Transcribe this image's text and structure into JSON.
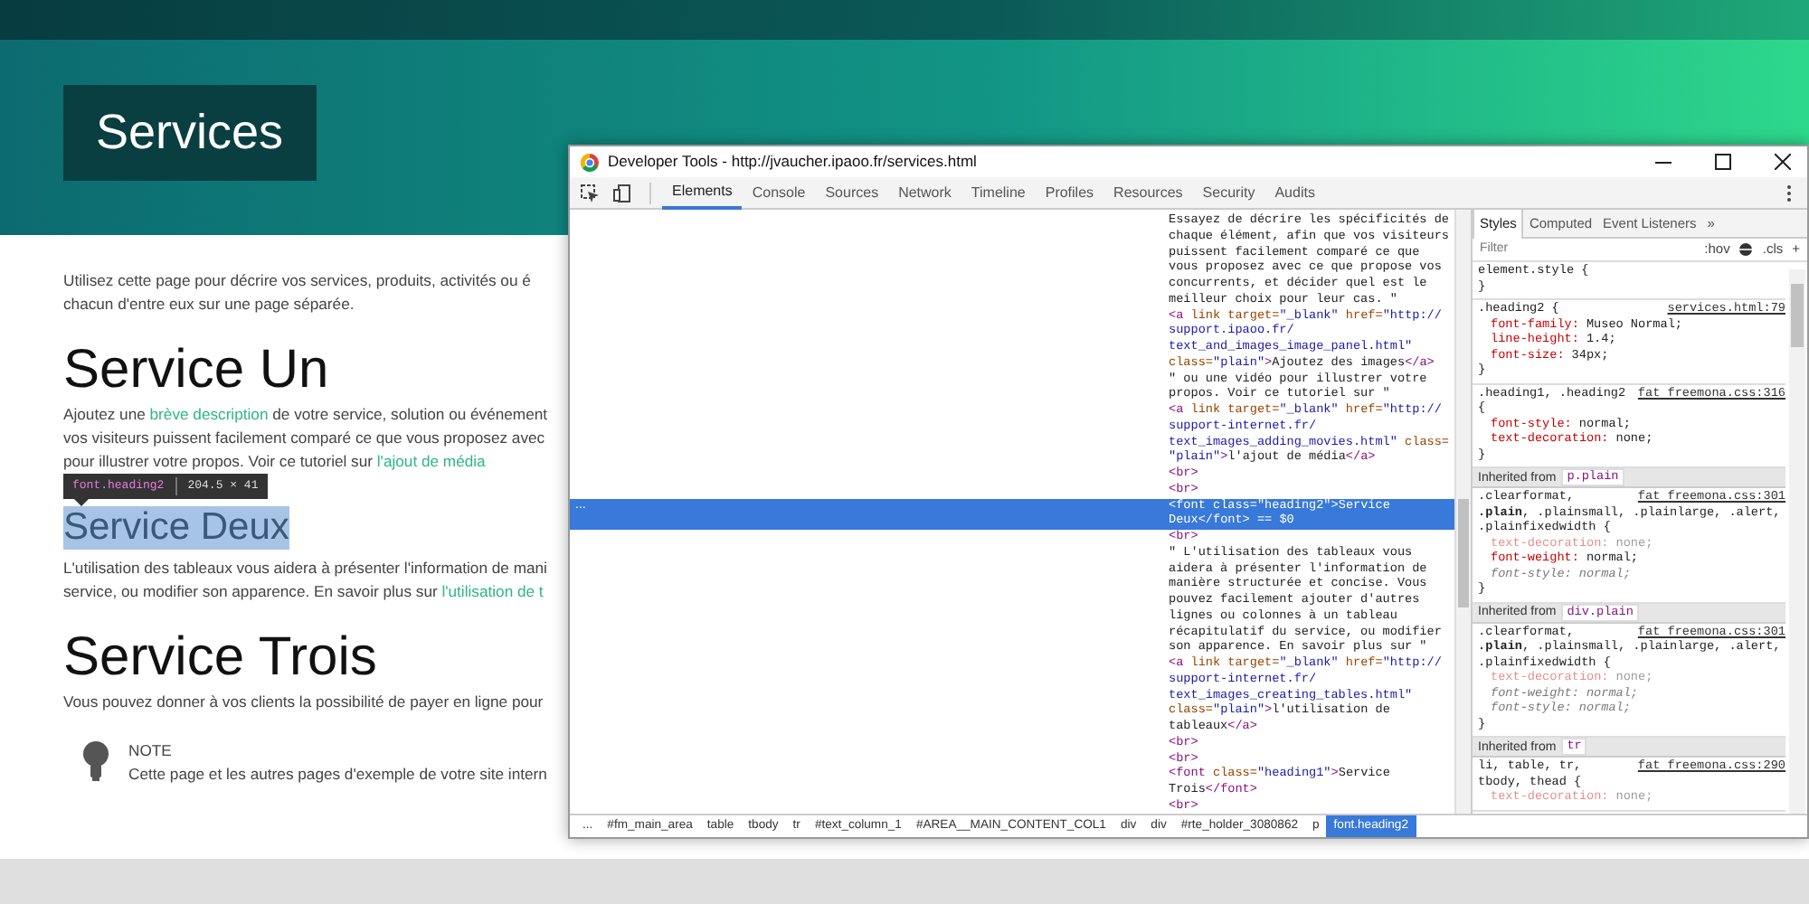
{
  "page": {
    "title": "Services",
    "blocks": [
      {
        "kind": "para",
        "lines": [
          {
            "parts": [
              {
                "kind": "text",
                "text": "Utilisez cette page pour décrire vos services, produits, activités ou é"
              }
            ]
          },
          {
            "parts": [
              {
                "kind": "text",
                "text": "chacun d'entre eux sur une page séparée."
              }
            ]
          }
        ]
      },
      {
        "kind": "heading",
        "text": "Service Un",
        "selected": false
      },
      {
        "kind": "para",
        "lines": [
          {
            "parts": [
              {
                "kind": "text",
                "text": "Ajoutez une "
              },
              {
                "kind": "link",
                "text": "brève description"
              },
              {
                "kind": "text",
                "text": " de votre service, solution ou événement"
              }
            ]
          },
          {
            "parts": [
              {
                "kind": "text",
                "text": "vos visiteurs puissent facilement comparé ce que vous proposez avec"
              }
            ]
          },
          {
            "parts": [
              {
                "kind": "text",
                "text": "pour illustrer votre propos. Voir ce tutoriel sur "
              },
              {
                "kind": "link",
                "text": "l'ajout de média"
              }
            ]
          }
        ]
      },
      {
        "kind": "subheading",
        "text": "Service Deux",
        "selected": true,
        "tooltip": {
          "selector": "font.heading2",
          "size": "204.5 × 41"
        }
      },
      {
        "kind": "para",
        "lines": [
          {
            "parts": [
              {
                "kind": "text",
                "text": "L'utilisation des tableaux vous aidera à présenter l'information de mani"
              }
            ]
          },
          {
            "parts": [
              {
                "kind": "text",
                "text": "service, ou modifier son apparence. En savoir plus sur "
              },
              {
                "kind": "link",
                "text": "l'utilisation de t"
              }
            ]
          }
        ]
      },
      {
        "kind": "heading",
        "text": "Service Trois",
        "selected": false
      },
      {
        "kind": "para",
        "lines": [
          {
            "parts": [
              {
                "kind": "text",
                "text": "Vous pouvez donner à vos clients la possibilité de payer en ligne pour"
              }
            ]
          }
        ]
      },
      {
        "kind": "note",
        "title": "NOTE",
        "text": "Cette page et les autres pages d'exemple de votre site intern"
      }
    ]
  },
  "devtools": {
    "title": "Developer Tools - http://jvaucher.ipaoo.fr/services.html",
    "tabs": [
      {
        "label": "Elements",
        "selected": true
      },
      {
        "label": "Console",
        "selected": false
      },
      {
        "label": "Sources",
        "selected": false
      },
      {
        "label": "Network",
        "selected": false
      },
      {
        "label": "Timeline",
        "selected": false
      },
      {
        "label": "Profiles",
        "selected": false
      },
      {
        "label": "Resources",
        "selected": false
      },
      {
        "label": "Security",
        "selected": false
      },
      {
        "label": "Audits",
        "selected": false
      }
    ],
    "elements": {
      "gutter": "...",
      "lines": [
        {
          "selected": false,
          "parts": [
            {
              "kind": "text",
              "text": "Essayez de décrire les spécificités de"
            }
          ]
        },
        {
          "selected": false,
          "parts": [
            {
              "kind": "text",
              "text": "chaque élément, afin que vos visiteurs"
            }
          ]
        },
        {
          "selected": false,
          "parts": [
            {
              "kind": "text",
              "text": "puissent facilement comparé ce que"
            }
          ]
        },
        {
          "selected": false,
          "parts": [
            {
              "kind": "text",
              "text": "vous proposez avec ce que propose vos"
            }
          ]
        },
        {
          "selected": false,
          "parts": [
            {
              "kind": "text",
              "text": "concurrents, et décider quel est le"
            }
          ]
        },
        {
          "selected": false,
          "parts": [
            {
              "kind": "text",
              "text": "meilleur choix pour leur cas. \""
            }
          ]
        },
        {
          "selected": false,
          "parts": [
            {
              "kind": "tag",
              "text": "<a"
            },
            {
              "kind": "attr",
              "text": " link target="
            },
            {
              "kind": "value",
              "text": "\"_blank\""
            },
            {
              "kind": "attr",
              "text": " href="
            },
            {
              "kind": "value",
              "text": "\"http://"
            }
          ]
        },
        {
          "selected": false,
          "parts": [
            {
              "kind": "value",
              "text": "support.ipaoo.fr/"
            }
          ]
        },
        {
          "selected": false,
          "parts": [
            {
              "kind": "value",
              "text": "text_and_images_image_panel.html\""
            }
          ]
        },
        {
          "selected": false,
          "parts": [
            {
              "kind": "attr",
              "text": "class="
            },
            {
              "kind": "value",
              "text": "\"plain\""
            },
            {
              "kind": "tag",
              "text": ">"
            },
            {
              "kind": "text",
              "text": "Ajoutez des images"
            },
            {
              "kind": "tag",
              "text": "</a>"
            }
          ]
        },
        {
          "selected": false,
          "parts": [
            {
              "kind": "text",
              "text": "\" ou une vidéo pour illustrer votre"
            }
          ]
        },
        {
          "selected": false,
          "parts": [
            {
              "kind": "text",
              "text": "propos. Voir ce tutoriel sur \""
            }
          ]
        },
        {
          "selected": false,
          "parts": [
            {
              "kind": "tag",
              "text": "<a"
            },
            {
              "kind": "attr",
              "text": " link target="
            },
            {
              "kind": "value",
              "text": "\"_blank\""
            },
            {
              "kind": "attr",
              "text": " href="
            },
            {
              "kind": "value",
              "text": "\"http://"
            }
          ]
        },
        {
          "selected": false,
          "parts": [
            {
              "kind": "value",
              "text": "support-internet.fr/"
            }
          ]
        },
        {
          "selected": false,
          "parts": [
            {
              "kind": "value",
              "text": "text_images_adding_movies.html\""
            },
            {
              "kind": "attr",
              "text": " class="
            }
          ]
        },
        {
          "selected": false,
          "parts": [
            {
              "kind": "value",
              "text": "\"plain\""
            },
            {
              "kind": "tag",
              "text": ">"
            },
            {
              "kind": "text",
              "text": "l'ajout de média"
            },
            {
              "kind": "tag",
              "text": "</a>"
            }
          ]
        },
        {
          "selected": false,
          "parts": [
            {
              "kind": "tag",
              "text": "<br>"
            }
          ]
        },
        {
          "selected": false,
          "parts": [
            {
              "kind": "tag",
              "text": "<br>"
            }
          ]
        },
        {
          "selected": true,
          "parts": [
            {
              "kind": "tag",
              "text": "<font"
            },
            {
              "kind": "attr",
              "text": " class="
            },
            {
              "kind": "value",
              "text": "\"heading2\""
            },
            {
              "kind": "tag",
              "text": ">"
            },
            {
              "kind": "text",
              "text": "Service"
            }
          ]
        },
        {
          "selected": true,
          "parts": [
            {
              "kind": "text",
              "text": "Deux"
            },
            {
              "kind": "tag",
              "text": "</font>"
            },
            {
              "kind": "dim",
              "text": " == $0"
            }
          ]
        },
        {
          "selected": false,
          "parts": [
            {
              "kind": "tag",
              "text": "<br>"
            }
          ]
        },
        {
          "selected": false,
          "parts": [
            {
              "kind": "text",
              "text": "\" L'utilisation des tableaux vous"
            }
          ]
        },
        {
          "selected": false,
          "parts": [
            {
              "kind": "text",
              "text": "aidera à présenter l'information de"
            }
          ]
        },
        {
          "selected": false,
          "parts": [
            {
              "kind": "text",
              "text": "manière structurée et concise. Vous"
            }
          ]
        },
        {
          "selected": false,
          "parts": [
            {
              "kind": "text",
              "text": "pouvez facilement ajouter d'autres"
            }
          ]
        },
        {
          "selected": false,
          "parts": [
            {
              "kind": "text",
              "text": "lignes ou colonnes à un tableau"
            }
          ]
        },
        {
          "selected": false,
          "parts": [
            {
              "kind": "text",
              "text": "récapitulatif du service, ou modifier"
            }
          ]
        },
        {
          "selected": false,
          "parts": [
            {
              "kind": "text",
              "text": "son apparence. En savoir plus sur \""
            }
          ]
        },
        {
          "selected": false,
          "parts": [
            {
              "kind": "tag",
              "text": "<a"
            },
            {
              "kind": "attr",
              "text": " link target="
            },
            {
              "kind": "value",
              "text": "\"_blank\""
            },
            {
              "kind": "attr",
              "text": " href="
            },
            {
              "kind": "value",
              "text": "\"http://"
            }
          ]
        },
        {
          "selected": false,
          "parts": [
            {
              "kind": "value",
              "text": "support-internet.fr/"
            }
          ]
        },
        {
          "selected": false,
          "parts": [
            {
              "kind": "value",
              "text": "text_images_creating_tables.html\""
            }
          ]
        },
        {
          "selected": false,
          "parts": [
            {
              "kind": "attr",
              "text": "class="
            },
            {
              "kind": "value",
              "text": "\"plain\""
            },
            {
              "kind": "tag",
              "text": ">"
            },
            {
              "kind": "text",
              "text": "l'utilisation de"
            }
          ]
        },
        {
          "selected": false,
          "parts": [
            {
              "kind": "text",
              "text": "tableaux"
            },
            {
              "kind": "tag",
              "text": "</a>"
            }
          ]
        },
        {
          "selected": false,
          "parts": [
            {
              "kind": "tag",
              "text": "<br>"
            }
          ]
        },
        {
          "selected": false,
          "parts": [
            {
              "kind": "tag",
              "text": "<br>"
            }
          ]
        },
        {
          "selected": false,
          "parts": [
            {
              "kind": "tag",
              "text": "<font"
            },
            {
              "kind": "attr",
              "text": " class="
            },
            {
              "kind": "value",
              "text": "\"heading1\""
            },
            {
              "kind": "tag",
              "text": ">"
            },
            {
              "kind": "text",
              "text": "Service"
            }
          ]
        },
        {
          "selected": false,
          "parts": [
            {
              "kind": "text",
              "text": "Trois"
            },
            {
              "kind": "tag",
              "text": "</font>"
            }
          ]
        },
        {
          "selected": false,
          "parts": [
            {
              "kind": "tag",
              "text": "<br>"
            }
          ]
        }
      ]
    },
    "styles": {
      "tabs": [
        {
          "label": "Styles",
          "selected": true
        },
        {
          "label": "Computed",
          "selected": false
        },
        {
          "label": "Event Listeners",
          "selected": false
        }
      ],
      "more": "»",
      "filter": {
        "placeholder": "Filter"
      },
      "hov": ":hov",
      "cls": ".cls",
      "add": "+",
      "blocks": [
        {
          "kind": "rule",
          "selector": [
            "element.style {"
          ],
          "close": "}"
        },
        {
          "kind": "rule",
          "selector": [
            ".heading2 {"
          ],
          "source": "services.html:79",
          "props": [
            {
              "name": "font-family:",
              "value": "Museo Normal;",
              "inactive": false,
              "overridden": false
            },
            {
              "name": "line-height:",
              "value": "1.4;",
              "inactive": false,
              "overridden": false
            },
            {
              "name": "font-size:",
              "value": "34px;",
              "inactive": false,
              "overridden": false
            }
          ],
          "close": "}"
        },
        {
          "kind": "rule",
          "selector": [
            ".heading1, .heading2",
            "{"
          ],
          "source": "fat freemona.css:316",
          "props": [
            {
              "name": "font-style:",
              "value": "normal;",
              "inactive": false,
              "overridden": false
            },
            {
              "name": "text-decoration:",
              "value": "none;",
              "inactive": false,
              "overridden": false
            }
          ],
          "close": "}"
        },
        {
          "kind": "inherited",
          "label": "Inherited from",
          "from": "p.plain"
        },
        {
          "kind": "rule",
          "selector": [
            ".clearformat,",
            "**.plain**, .plainsmall, .plainlarge, .alert,",
            ".plainfixedwidth {"
          ],
          "source": "fat freemona.css:301",
          "props": [
            {
              "name": "text-decoration:",
              "value": "none;",
              "inactive": true,
              "overridden": false
            },
            {
              "name": "font-weight:",
              "value": "normal;",
              "inactive": false,
              "overridden": false
            },
            {
              "name": "font-style:",
              "value": "normal;",
              "inactive": false,
              "overridden": true
            }
          ],
          "close": "}"
        },
        {
          "kind": "inherited",
          "label": "Inherited from",
          "from": "div.plain"
        },
        {
          "kind": "rule",
          "selector": [
            ".clearformat,",
            "**.plain**, .plainsmall, .plainlarge, .alert,",
            ".plainfixedwidth {"
          ],
          "source": "fat freemona.css:301",
          "props": [
            {
              "name": "text-decoration:",
              "value": "none;",
              "inactive": true,
              "overridden": false
            },
            {
              "name": "font-weight:",
              "value": "normal;",
              "inactive": false,
              "overridden": true
            },
            {
              "name": "font-style:",
              "value": "normal;",
              "inactive": false,
              "overridden": true
            }
          ],
          "close": "}"
        },
        {
          "kind": "inherited",
          "label": "Inherited from",
          "from": "tr"
        },
        {
          "kind": "rule",
          "selector": [
            "li, table, tr,",
            "tbody, thead {"
          ],
          "source": "fat freemona.css:290",
          "props": [
            {
              "name": "text-decoration:",
              "value": "none;",
              "inactive": true,
              "overridden": false
            }
          ]
        }
      ]
    },
    "breadcrumb": [
      {
        "label": "...",
        "selected": false
      },
      {
        "label": "#fm_main_area",
        "selected": false
      },
      {
        "label": "table",
        "selected": false
      },
      {
        "label": "tbody",
        "selected": false
      },
      {
        "label": "tr",
        "selected": false
      },
      {
        "label": "#text_column_1",
        "selected": false
      },
      {
        "label": "#AREA__MAIN_CONTENT_COL1",
        "selected": false
      },
      {
        "label": "div",
        "selected": false
      },
      {
        "label": "div",
        "selected": false
      },
      {
        "label": "#rte_holder_3080862",
        "selected": false
      },
      {
        "label": "p",
        "selected": false
      },
      {
        "label": "font.heading2",
        "selected": true
      }
    ]
  }
}
